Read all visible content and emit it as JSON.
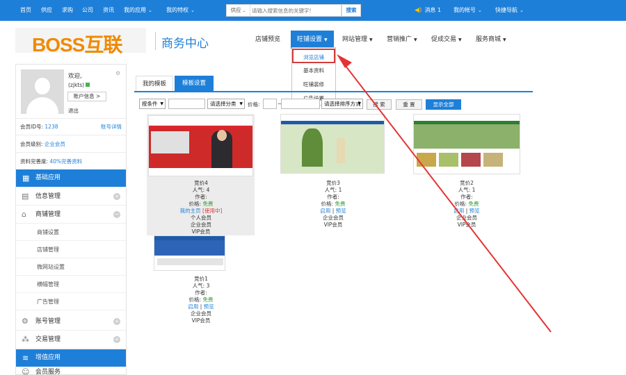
{
  "topbar": {
    "nav": [
      {
        "label": "首页"
      },
      {
        "label": "供应"
      },
      {
        "label": "求购"
      },
      {
        "label": "公司"
      },
      {
        "label": "资讯"
      },
      {
        "label": "我的应用",
        "dropdown": true
      },
      {
        "label": "我的特权",
        "dropdown": true
      }
    ],
    "search": {
      "category": "供应",
      "placeholder": "请输入搜索信息的关键字!",
      "button": "搜索"
    },
    "messages": "消息 1",
    "account": "我的帐号",
    "quick_nav": "快捷导航"
  },
  "header": {
    "logo_text": "BOSS互联",
    "page_title": "商务中心",
    "nav": [
      {
        "label": "店铺预览"
      },
      {
        "label": "旺铺设置",
        "active": true
      },
      {
        "label": "网站管理"
      },
      {
        "label": "营销推广"
      },
      {
        "label": "促成交易"
      },
      {
        "label": "服务商城"
      }
    ],
    "dropdown": [
      "浏览店铺",
      "基本资料",
      "旺铺装修",
      "广告设置"
    ]
  },
  "sidebar": {
    "welcome": "欢迎,",
    "username": "(zjkts)",
    "account_info_button": "账户信息 >",
    "logout": "退出",
    "member_id_label": "会员ID号:",
    "member_id": "1238",
    "account_detail": "账号详情",
    "member_level_label": "会员级别:",
    "member_level": "企业会员",
    "profile_label": "资料完善度:",
    "profile_value": "40%完善资料",
    "sections": [
      {
        "label": "基础应用"
      },
      {
        "label": "增值应用"
      }
    ],
    "menu": [
      {
        "label": "信息管理"
      },
      {
        "label": "商铺管理"
      },
      {
        "label": "账号管理"
      },
      {
        "label": "交易管理"
      },
      {
        "label": "会员服务"
      }
    ],
    "submenu": [
      "商铺设置",
      "店铺管理",
      "微网站设置",
      "横幅管理",
      "广告管理"
    ]
  },
  "main": {
    "tabs": [
      "我的模板",
      "模板设置"
    ],
    "filters": {
      "condition": "按条件",
      "category": "请选择分类",
      "price_label": "价格:",
      "price_sep": "~",
      "sort": "请选择排序方式",
      "search_button": "搜 索",
      "reset_button": "重 置",
      "show_all_button": "显示全部"
    },
    "templates": [
      {
        "name": "竞价4",
        "popularity": "人气: 4",
        "author": "作者:",
        "price_label": "价格:",
        "price": "免费",
        "links": [
          "我的主页",
          "[使用中]"
        ],
        "members": [
          "个人会员",
          "企业会员",
          "VIP会员"
        ]
      },
      {
        "name": "竞价3",
        "popularity": "人气: 1",
        "author": "作者:",
        "price_label": "价格:",
        "price": "免费",
        "links": [
          "启用",
          "|",
          "预览"
        ],
        "members": [
          "企业会员",
          "VIP会员"
        ]
      },
      {
        "name": "竞价2",
        "popularity": "人气: 1",
        "author": "作者:",
        "price_label": "价格:",
        "price": "免费",
        "links": [
          "启用",
          "|",
          "预览"
        ],
        "members": [
          "企业会员",
          "VIP会员"
        ]
      },
      {
        "name": "竞价1",
        "popularity": "人气: 3",
        "author": "作者:",
        "price_label": "价格:",
        "price": "免费",
        "links": [
          "启用",
          "|",
          "预览"
        ],
        "members": [
          "企业会员",
          "VIP会员"
        ]
      }
    ]
  },
  "colors": {
    "primary": "#1e7fd8",
    "logo": "#f08a00",
    "free": "#2b9a2b",
    "in_use": "#d23c3c",
    "arrow": "#e53333"
  }
}
